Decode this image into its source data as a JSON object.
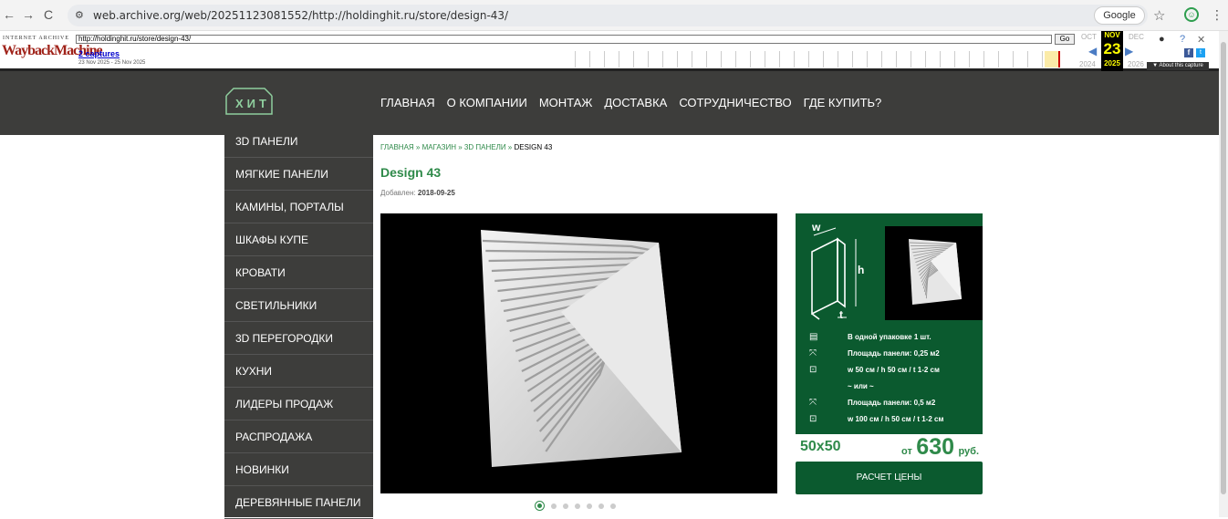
{
  "browser": {
    "url": "web.archive.org/web/20251123081552/http://holdinghit.ru/store/design-43/",
    "google_label": "Google"
  },
  "wayback": {
    "logo_top": "INTERNET ARCHIVE",
    "logo": "WaybackMachine",
    "url_value": "http://holdinghit.ru/store/design-43/",
    "go": "Go",
    "captures": "2 captures",
    "dates": "23 Nov 2025 - 25 Nov 2025",
    "prev_month": "OCT",
    "cur_month": "NOV",
    "next_month": "DEC",
    "cur_day": "23",
    "prev_year": "2024",
    "cur_year": "2025",
    "next_year": "2026",
    "about": "▼ About this capture"
  },
  "site": {
    "logo": "ХИТ",
    "nav": [
      "ГЛАВНАЯ",
      "О КОМПАНИИ",
      "МОНТАЖ",
      "ДОСТАВКА",
      "СОТРУДНИЧЕСТВО",
      "ГДЕ КУПИТЬ?"
    ],
    "sidebar": [
      "3D ПАНЕЛИ",
      "МЯГКИЕ ПАНЕЛИ",
      "КАМИНЫ, ПОРТАЛЫ",
      "ШКАФЫ КУПЕ",
      "КРОВАТИ",
      "СВЕТИЛЬНИКИ",
      "3D ПЕРЕГОРОДКИ",
      "КУХНИ",
      "ЛИДЕРЫ ПРОДАЖ",
      "РАСПРОДАЖА",
      "НОВИНКИ",
      "ДЕРЕВЯННЫЕ ПАНЕЛИ"
    ]
  },
  "product": {
    "breadcrumb": {
      "home": "ГЛАВНАЯ",
      "store": "МАГАЗИН",
      "category": "3D ПАНЕЛИ",
      "current": "DESIGN 43",
      "sep": " » "
    },
    "title": "Design 43",
    "added_label": "Добавлен:",
    "added_date": "2018-09-25",
    "dims": {
      "w": "w",
      "h": "h",
      "t": "t"
    },
    "specs": [
      {
        "icon": "box-icon",
        "glyph": "▤",
        "text": "В одной упаковке 1 шт."
      },
      {
        "icon": "expand-icon",
        "glyph": "⤧",
        "text": "Площадь панели: 0,25 м2"
      },
      {
        "icon": "dimensions-icon",
        "glyph": "⊡",
        "text": "w 50 см / h 50 см / t 1-2 см"
      },
      {
        "icon": "",
        "glyph": "",
        "text": "~ или ~"
      },
      {
        "icon": "expand-icon",
        "glyph": "⤧",
        "text": "Площадь панели: 0,5 м2"
      },
      {
        "icon": "dimensions-icon",
        "glyph": "⊡",
        "text": "w 100 см / h 50 см / t 1-2 см"
      }
    ],
    "size": "50x50",
    "price_from": "от",
    "price": "630",
    "currency": "руб.",
    "calc_button": "РАСЧЕТ ЦЕНЫ",
    "slides": 7
  }
}
